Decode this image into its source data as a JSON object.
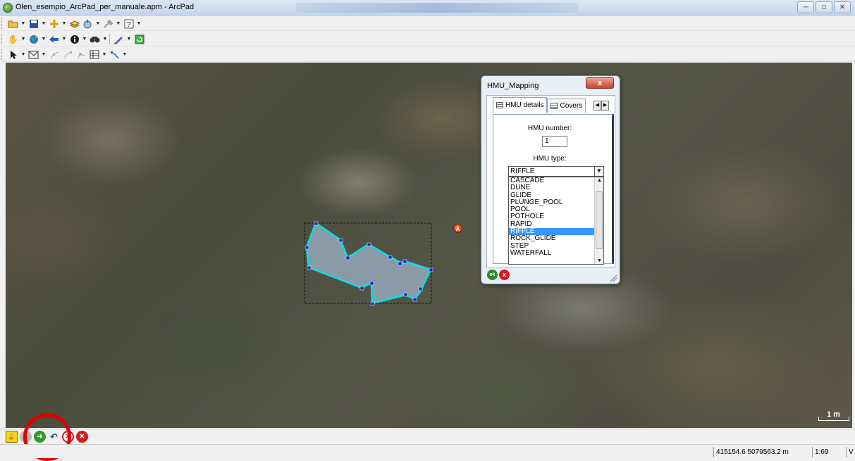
{
  "window": {
    "title": "Olen_esempio_ArcPad_per_manuale.apm - ArcPad",
    "controls": [
      "minimize",
      "maximize",
      "close"
    ]
  },
  "toolbars": {
    "file": [
      "open-icon",
      "save-icon",
      "add-layer-icon",
      "layers-icon",
      "gps-icon",
      "tools-icon",
      "help-icon"
    ],
    "navigation": [
      "pan-icon",
      "globe-icon",
      "back-icon",
      "info-icon",
      "find-icon",
      "edit-icon",
      "refresh-icon"
    ],
    "edit": [
      "select-icon",
      "polygon-icon",
      "vertex-icon",
      "vertex-edit-icon",
      "vertex-move-icon",
      "attributes-icon",
      "line-icon"
    ]
  },
  "map": {
    "point_label": "A",
    "scale_bar": "1 m"
  },
  "dialog": {
    "title": "HMU_Mapping",
    "close_label": "x",
    "tabs": [
      "HMU details",
      "Covers"
    ],
    "hmu_number_label": "HMU number:",
    "hmu_number_value": "1",
    "hmu_type_label": "HMU type:",
    "hmu_type_value": "RIFFLE",
    "hmu_type_options": [
      "CASCADE",
      "DUNE",
      "GLIDE",
      "PLUNGE_POOL",
      "POOL",
      "POTHOLE",
      "RAPID",
      "RIFFLE",
      "ROCK_GLIDE",
      "STEP",
      "WATERFALL"
    ],
    "selected_option": "RIFFLE",
    "ok_label": "ok",
    "cancel_label": "x"
  },
  "edit_toolbar": {
    "buttons": [
      "lock-icon",
      "check-icon",
      "proceed-icon",
      "undo-icon",
      "stop-icon",
      "cancel-icon"
    ]
  },
  "statusbar": {
    "coordinates": "415154.6 5079563.2 m",
    "scale": "1:69",
    "extra": "V"
  },
  "colors": {
    "polygon_fill": "#8a9aa6",
    "polygon_outline": "#00e5e5",
    "vertex": "#1030c8",
    "highlight_circle": "#e30000",
    "selection": "#3399ff"
  }
}
